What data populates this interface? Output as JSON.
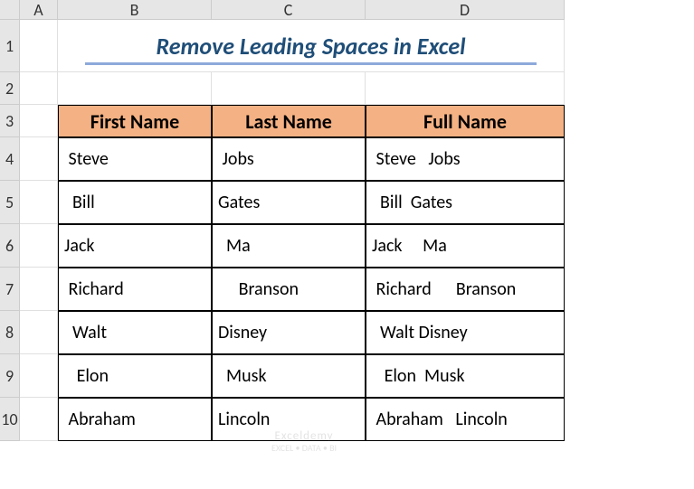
{
  "columns": {
    "a": "A",
    "b": "B",
    "c": "C",
    "d": "D"
  },
  "rows": {
    "r1": "1",
    "r2": "2",
    "r3": "3",
    "r4": "4",
    "r5": "5",
    "r6": "6",
    "r7": "7",
    "r8": "8",
    "r9": "9",
    "r10": "10"
  },
  "title": "Remove Leading Spaces in Excel",
  "headers": {
    "first_name": "First Name",
    "last_name": "Last Name",
    "full_name": "Full Name"
  },
  "data": [
    {
      "first": " Steve",
      "last": " Jobs",
      "full": " Steve   Jobs"
    },
    {
      "first": "  Bill",
      "last": "Gates",
      "full": "  Bill  Gates"
    },
    {
      "first": "Jack",
      "last": "  Ma",
      "full": "Jack     Ma"
    },
    {
      "first": " Richard",
      "last": "     Branson",
      "full": " Richard      Branson"
    },
    {
      "first": "  Walt",
      "last": "Disney",
      "full": "  Walt Disney"
    },
    {
      "first": "   Elon",
      "last": "  Musk",
      "full": "   Elon  Musk"
    },
    {
      "first": " Abraham",
      "last": "Lincoln",
      "full": " Abraham   Lincoln"
    }
  ],
  "watermark": {
    "brand": "Exceldemy",
    "sub": "EXCEL • DATA • BI"
  },
  "chart_data": {
    "type": "table",
    "title": "Remove Leading Spaces in Excel",
    "columns": [
      "First Name",
      "Last Name",
      "Full Name"
    ],
    "rows": [
      [
        " Steve",
        " Jobs",
        " Steve   Jobs"
      ],
      [
        "  Bill",
        "Gates",
        "  Bill  Gates"
      ],
      [
        "Jack",
        "  Ma",
        "Jack     Ma"
      ],
      [
        " Richard",
        "     Branson",
        " Richard      Branson"
      ],
      [
        "  Walt",
        "Disney",
        "  Walt Disney"
      ],
      [
        "   Elon",
        "  Musk",
        "   Elon  Musk"
      ],
      [
        " Abraham",
        "Lincoln",
        " Abraham   Lincoln"
      ]
    ]
  }
}
